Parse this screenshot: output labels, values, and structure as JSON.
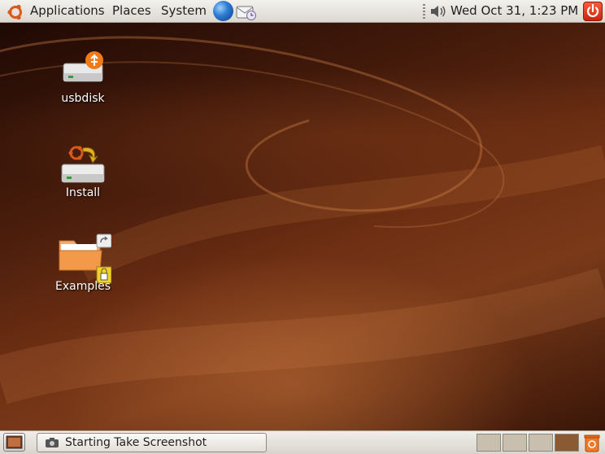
{
  "top_panel": {
    "menus": [
      "Applications",
      "Places",
      "System"
    ],
    "clock": "Wed Oct 31,  1:23 PM",
    "launchers": [
      "web-browser-icon",
      "mail-client-icon"
    ]
  },
  "desktop": {
    "icons": [
      {
        "label": "usbdisk"
      },
      {
        "label": "Install"
      },
      {
        "label": "Examples"
      }
    ]
  },
  "bottom_panel": {
    "task_label": "Starting Take Screenshot",
    "workspace_count": 4,
    "active_workspace": 4
  },
  "colors": {
    "accent": "#e05a1a",
    "panel": "#e4e0d9",
    "wallpaper": "#5c2510"
  }
}
